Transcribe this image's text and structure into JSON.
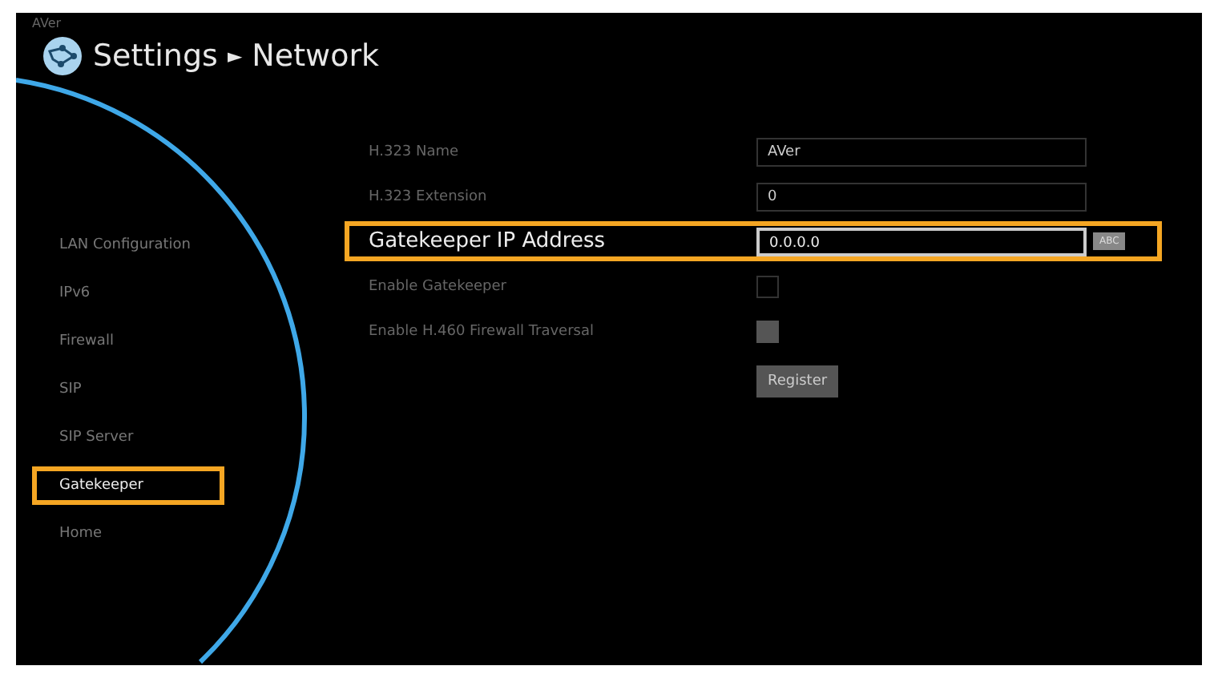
{
  "brand": "AVer",
  "title": {
    "section": "Settings",
    "separator": "►",
    "page": "Network"
  },
  "sidebar": {
    "items": [
      {
        "label": "LAN Configuration",
        "selected": false
      },
      {
        "label": "IPv6",
        "selected": false
      },
      {
        "label": "Firewall",
        "selected": false
      },
      {
        "label": "SIP",
        "selected": false
      },
      {
        "label": "SIP Server",
        "selected": false
      },
      {
        "label": "Gatekeeper",
        "selected": true
      },
      {
        "label": "Home",
        "selected": false
      }
    ]
  },
  "form": {
    "rows": [
      {
        "kind": "text",
        "label": "H.323 Name",
        "value": "AVer",
        "focused": false
      },
      {
        "kind": "text",
        "label": "H.323 Extension",
        "value": "0",
        "focused": false
      },
      {
        "kind": "text",
        "label": "Gatekeeper IP Address",
        "value": "0.0.0.0",
        "focused": true,
        "input_mode": "ABC"
      },
      {
        "kind": "checkbox",
        "label": "Enable Gatekeeper",
        "disabled": false
      },
      {
        "kind": "checkbox",
        "label": "Enable H.460 Firewall Traversal",
        "disabled": true
      },
      {
        "kind": "button",
        "label": "Register"
      }
    ]
  }
}
